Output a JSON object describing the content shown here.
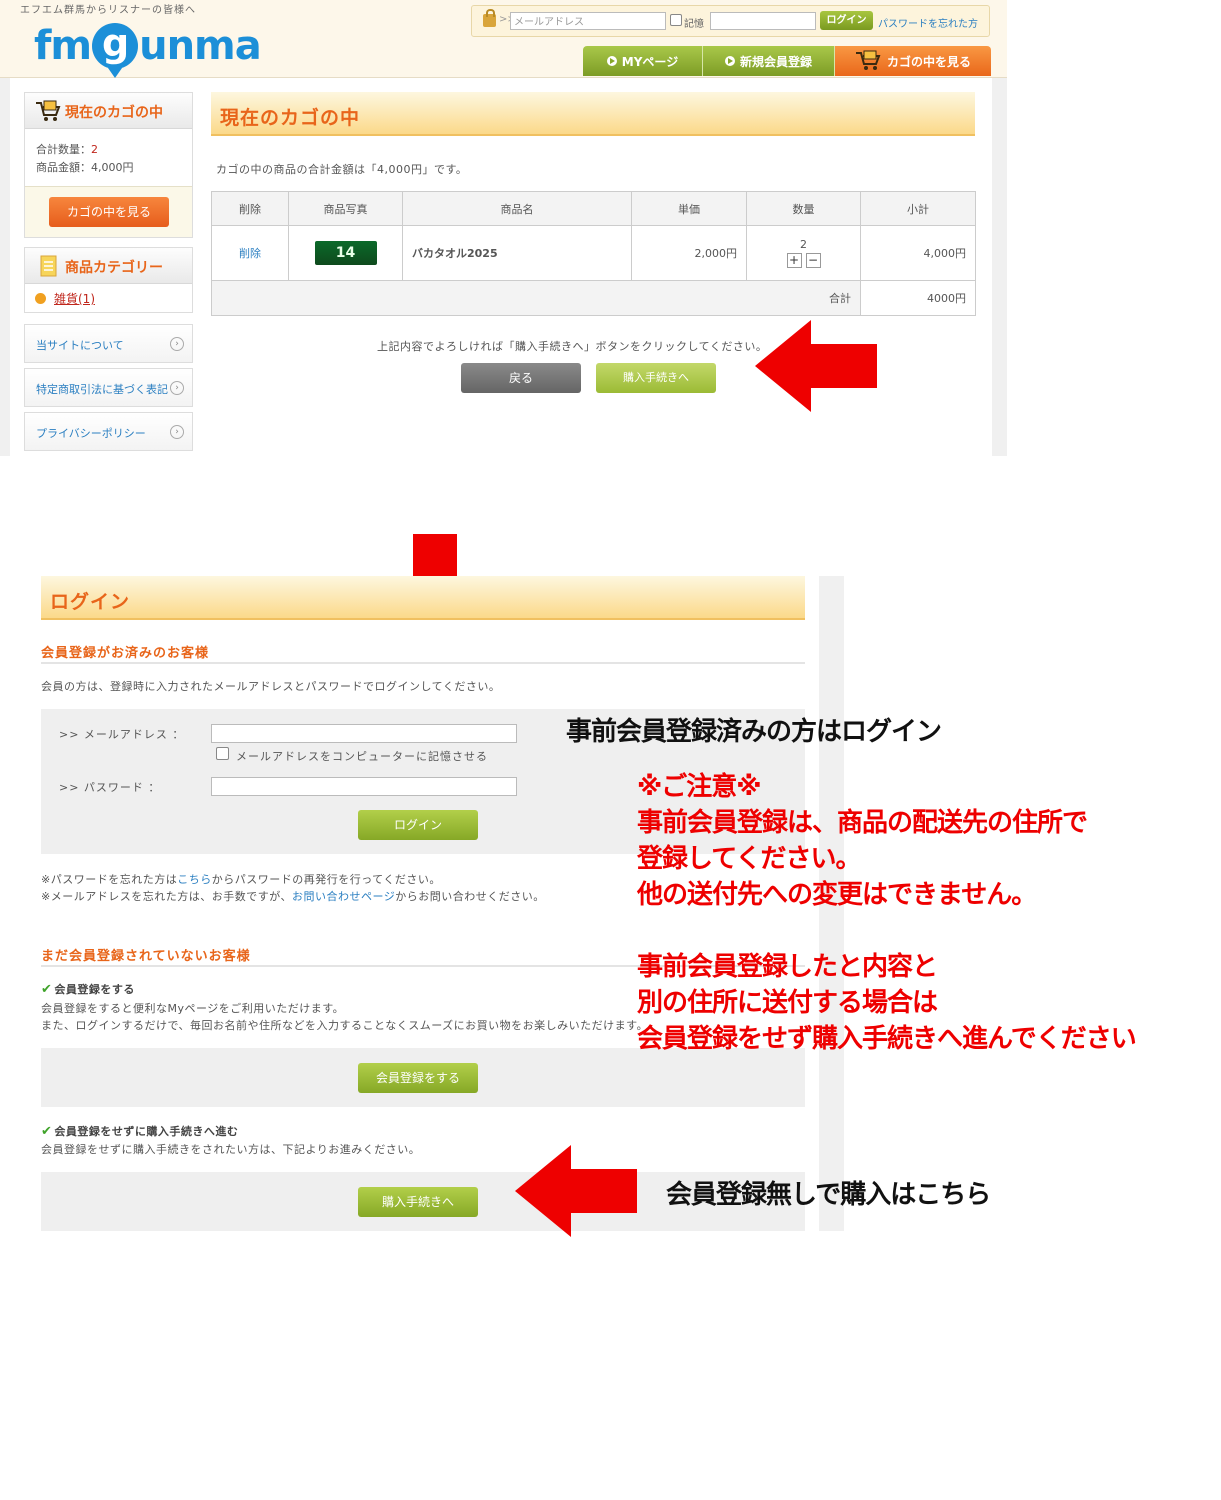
{
  "header": {
    "tagline": "エフエム群馬からリスナーの皆様へ",
    "logo_prefix": "fm",
    "logo_g": "g",
    "logo_suffix": "unma",
    "email_placeholder": "メールアドレス",
    "remember_label": "記憶",
    "login_label": "ログイン",
    "forgot_label": "パスワードを忘れた方"
  },
  "nav": {
    "mypage": "MYページ",
    "register": "新規会員登録",
    "cart": "カゴの中を見る"
  },
  "sidebar": {
    "cart_title": "現在のカゴの中",
    "qty_label": "合計数量：",
    "qty_value": "2",
    "amount_label": "商品金額：4,000円",
    "cart_button": "カゴの中を見る",
    "category_title": "商品カテゴリー",
    "category_item": "雑貨(1)",
    "links": [
      "当サイトについて",
      "特定商取引法に基づく表記",
      "プライバシーポリシー"
    ]
  },
  "cart_page": {
    "title": "現在のカゴの中",
    "total_message": "カゴの中の商品の合計金額は「4,000円」です。",
    "columns": [
      "削除",
      "商品写真",
      "商品名",
      "単価",
      "数量",
      "小計"
    ],
    "row": {
      "delete": "削除",
      "thumb_text": "14",
      "name": "バカタオル2025",
      "unit_price": "2,000円",
      "qty": "2",
      "subtotal": "4,000円"
    },
    "total_label": "合計",
    "total_value": "4000円",
    "confirm_message": "上記内容でよろしければ「購入手続きへ」ボタンをクリックしてください。",
    "back_button": "戻る",
    "purchase_button": "購入手続きへ"
  },
  "login_page": {
    "title": "ログイン",
    "member_heading": "会員登録がお済みのお客様",
    "member_desc": "会員の方は、登録時に入力されたメールアドレスとパスワードでログインしてください。",
    "email_label": ">> メールアドレス ：",
    "remember_label": "メールアドレスをコンピューターに記憶させる",
    "password_label": ">> パスワード ：",
    "login_button": "ログイン",
    "forgot_pw_pre": "※パスワードを忘れた方は",
    "forgot_pw_link": "こちら",
    "forgot_pw_post": "からパスワードの再発行を行ってください。",
    "forgot_mail_pre": "※メールアドレスを忘れた方は、お手数ですが、",
    "forgot_mail_link": "お問い合わせページ",
    "forgot_mail_post": "からお問い合わせください。",
    "guest_heading": "まだ会員登録されていないお客様",
    "register_title": "会員登録をする",
    "register_desc1": "会員登録をすると便利なMyページをご利用いただけます。",
    "register_desc2": "また、ログインするだけで、毎回お名前や住所などを入力することなくスムーズにお買い物をお楽しみいただけます。",
    "register_button": "会員登録をする",
    "guest_title": "会員登録をせずに購入手続きへ進む",
    "guest_desc": "会員登録をせずに購入手続きをされたい方は、下記よりお進みください。",
    "guest_button": "購入手続きへ"
  },
  "annotations": {
    "login_note": "事前会員登録済みの方はログイン",
    "caution_lines": [
      "※ご注意※",
      "事前会員登録は、商品の配送先の住所で",
      "登録してください。",
      "他の送付先への変更はできません。",
      "",
      "事前会員登録したと内容と",
      "別の住所に送付する場合は",
      "会員登録をせず購入手続きへ進んでください"
    ],
    "guest_note": "会員登録無しで購入はこちら"
  },
  "colors": {
    "accent_orange": "#e8651a",
    "nav_green": "#8fb033",
    "arrow_red": "#ee0000",
    "link_blue": "#2b7fc1"
  }
}
